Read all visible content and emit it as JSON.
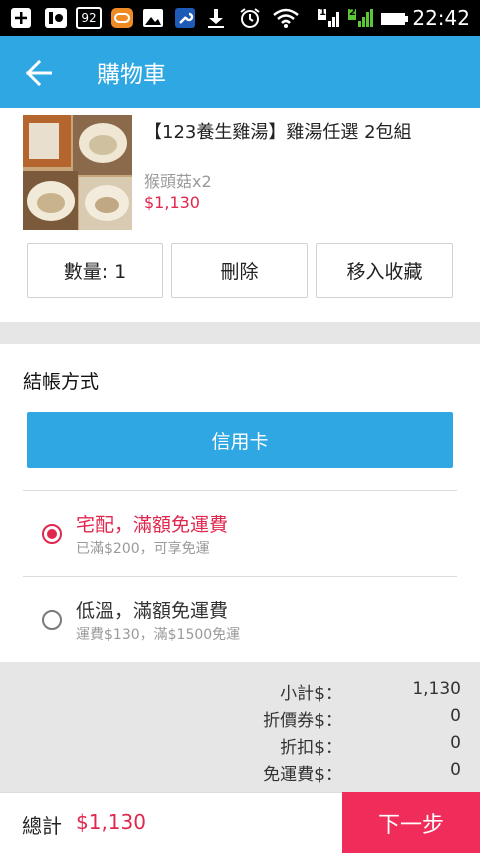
{
  "status_bar": {
    "time": "22:42",
    "notification_badge": "92",
    "sim1_label": "1",
    "sim2_label": "2",
    "icons": [
      "plus-square-icon",
      "gallery-icon",
      "92-badge-icon",
      "chat-icon",
      "image-icon",
      "wrench-icon",
      "download-icon",
      "alarm-icon",
      "wifi-icon",
      "signal-sim1-icon",
      "signal-sim2-icon",
      "battery-icon"
    ]
  },
  "app_bar": {
    "title": "購物車",
    "back_icon": "back-arrow-icon"
  },
  "product": {
    "name": "【123養生雞湯】雞湯任選 2包組",
    "variant": "猴頭菇x2",
    "price": "$1,130",
    "quantity_label": "數量: 1",
    "delete_label": "刪除",
    "favorite_label": "移入收藏"
  },
  "payment": {
    "section_title": "結帳方式",
    "method_label": "信用卡"
  },
  "shipping": [
    {
      "title": "宅配，滿額免運費",
      "note": "已滿$200，可享免運",
      "selected": true
    },
    {
      "title": "低溫，滿額免運費",
      "note": "運費$130，滿$1500免運",
      "selected": false
    }
  ],
  "summary": {
    "rows": [
      {
        "label": "小計$：",
        "value": "1,130"
      },
      {
        "label": "折價券$：",
        "value": "0"
      },
      {
        "label": "折扣$：",
        "value": "0"
      },
      {
        "label": "免運費$：",
        "value": "0"
      }
    ]
  },
  "footer": {
    "total_label": "總計",
    "total_value": "$1,130",
    "next_label": "下一步"
  },
  "colors": {
    "primary": "#2fa7e3",
    "accent_red": "#e0284f",
    "next_button": "#f02d5a"
  }
}
